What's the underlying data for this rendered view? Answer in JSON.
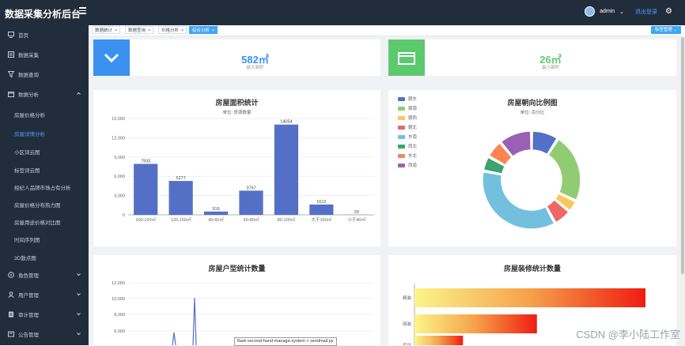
{
  "app": {
    "title": "数据采集分析后台",
    "user": "admin",
    "logout": "退出登录"
  },
  "sidebar": {
    "items": [
      {
        "label": "首页",
        "icon": "monitor-icon"
      },
      {
        "label": "数据采集",
        "icon": "collect-icon"
      },
      {
        "label": "数据查询",
        "icon": "filter-icon"
      },
      {
        "label": "数据分析",
        "icon": "analysis-icon"
      }
    ],
    "subitems": [
      "房屋价格分析",
      "房屋详情分析",
      "小区词云图",
      "标签词云图",
      "经纪人品牌市场占有分析",
      "房屋价格分布热力图",
      "房屋用途价格对比图",
      "时间序列图",
      "3D散点图"
    ],
    "bottom_items": [
      {
        "label": "角色管理",
        "icon": "role-icon"
      },
      {
        "label": "用户管理",
        "icon": "user-icon"
      },
      {
        "label": "审计管理",
        "icon": "audit-icon"
      },
      {
        "label": "公告管理",
        "icon": "notice-icon"
      }
    ]
  },
  "tabs": [
    {
      "label": "数据统计"
    },
    {
      "label": "数据查询"
    },
    {
      "label": "价格分析"
    },
    {
      "label": "综合分析"
    }
  ],
  "tab_close": "×",
  "tab_manager": "标签管理",
  "stats": [
    {
      "value": "582㎡",
      "label": "最大面积",
      "color": "#3a91f0"
    },
    {
      "value": "26㎡",
      "label": "最小面积",
      "color": "#5cc96e"
    }
  ],
  "area_chart": {
    "title": "房屋面积统计",
    "subtitle": "单位: 房源数量",
    "chart_data": {
      "type": "bar",
      "categories": [
        "100-120㎡",
        "120-150㎡",
        "40-60㎡",
        "60-80㎡",
        "80-100㎡",
        "大于150㎡",
        "小于40㎡"
      ],
      "values": [
        7933,
        5277,
        516,
        3767,
        14054,
        1612,
        29
      ],
      "ylim": [
        0,
        15000
      ],
      "yticks": [
        "0",
        "3,000",
        "6,000",
        "9,000",
        "12,000",
        "15,000"
      ],
      "color": "#5470c6"
    }
  },
  "orientation_chart": {
    "title": "房屋朝向比例图",
    "subtitle": "单位: 百分比",
    "chart_data": {
      "type": "pie",
      "legend": [
        "朝东",
        "朝南",
        "朝西",
        "朝北",
        "东南",
        "西北",
        "东北",
        "西南"
      ],
      "values": [
        9,
        23,
        4,
        6,
        36,
        5,
        6,
        11
      ],
      "colors": [
        "#5470c6",
        "#91cc75",
        "#fac858",
        "#ee6666",
        "#73c0de",
        "#3ba272",
        "#fc8452",
        "#9a60b4"
      ]
    }
  },
  "type_chart": {
    "title": "房屋户型统计数量",
    "yticks": [
      "6,000",
      "8,000",
      "10,000",
      "12,000"
    ]
  },
  "decor_chart": {
    "title": "房屋装修统计数量",
    "chart_data": {
      "type": "bar",
      "categories": [
        "精装",
        "简装",
        "毛坯"
      ],
      "values": [
        100,
        53,
        21
      ]
    }
  },
  "tooltip": "flask-second-hand-manage-system > sendmail.py",
  "watermark": "CSDN @李小陆工作室"
}
